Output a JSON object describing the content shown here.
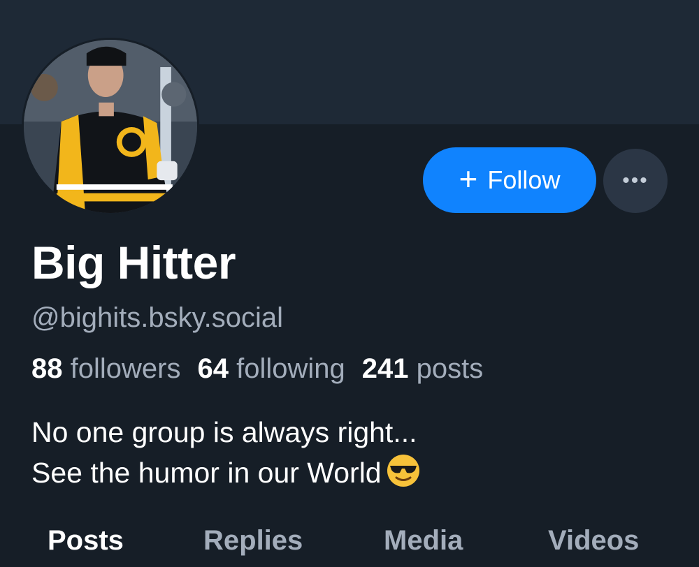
{
  "profile": {
    "display_name": "Big Hitter",
    "handle": "@bighits.bsky.social",
    "bio_line1": "No one group is always right...",
    "bio_line2": "See the humor in our World",
    "bio_emoji": "smiling-face-with-sunglasses"
  },
  "actions": {
    "follow_plus": "+",
    "follow_label": "Follow",
    "more_label": "•••"
  },
  "stats": {
    "followers_count": "88",
    "followers_label": "followers",
    "following_count": "64",
    "following_label": "following",
    "posts_count": "241",
    "posts_label": "posts"
  },
  "tabs": [
    {
      "label": "Posts",
      "active": true
    },
    {
      "label": "Replies",
      "active": false
    },
    {
      "label": "Media",
      "active": false
    },
    {
      "label": "Videos",
      "active": false
    }
  ],
  "colors": {
    "background": "#161e27",
    "banner": "#1e2936",
    "accent": "#1083fe",
    "secondary_text": "#a3adbb"
  }
}
